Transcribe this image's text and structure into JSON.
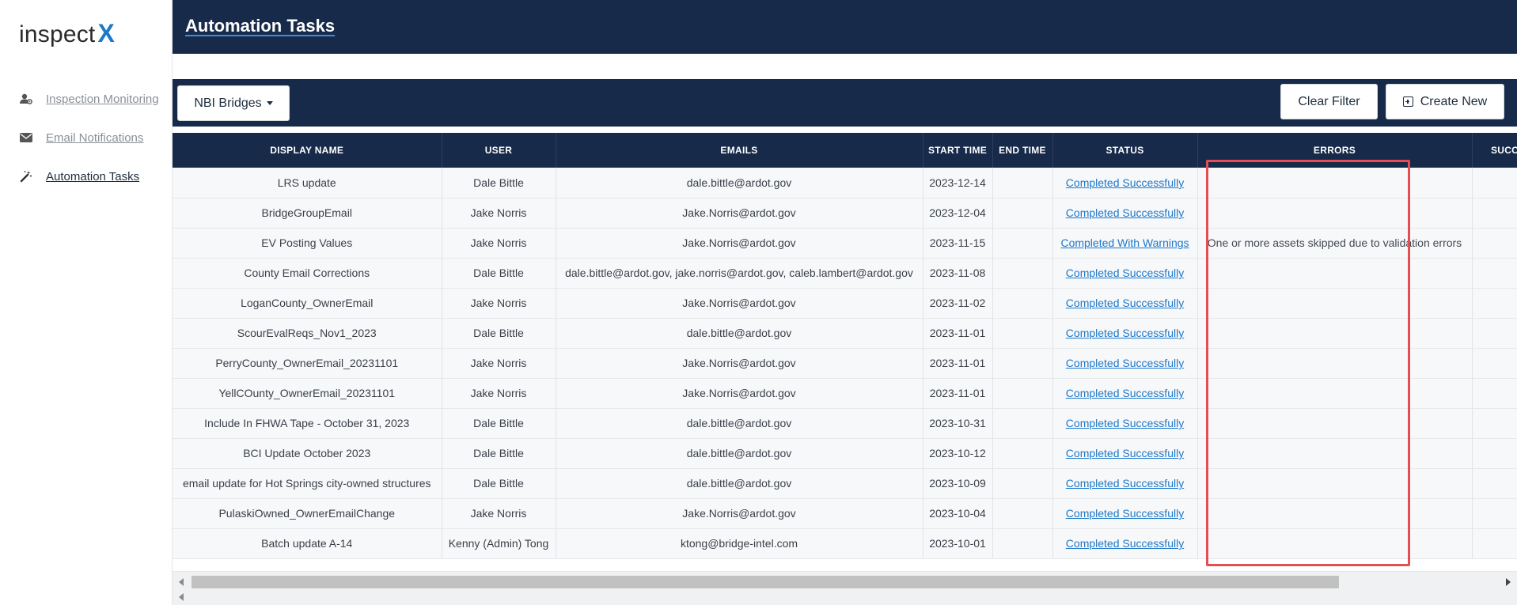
{
  "logo": {
    "text": "inspect",
    "x": "X"
  },
  "sidebar": {
    "items": [
      {
        "label": "Inspection Monitoring",
        "icon": "user-gear-icon"
      },
      {
        "label": "Email Notifications",
        "icon": "envelope-icon"
      },
      {
        "label": "Automation Tasks",
        "icon": "magic-wand-icon"
      }
    ]
  },
  "header": {
    "title": "Automation Tasks"
  },
  "toolbar": {
    "dropdown_label": "NBI Bridges",
    "clear_filter_label": "Clear Filter",
    "create_new_label": "Create New"
  },
  "table": {
    "columns": [
      "DISPLAY NAME",
      "USER",
      "EMAILS",
      "START TIME",
      "END TIME",
      "STATUS",
      "ERRORS",
      "SUCCESS"
    ],
    "rows": [
      {
        "name": "LRS update",
        "user": "Dale Bittle",
        "emails": "dale.bittle@ardot.gov",
        "start": "2023-12-14",
        "end": "",
        "status": "Completed Successfully",
        "errors": "",
        "success": ""
      },
      {
        "name": "BridgeGroupEmail",
        "user": "Jake Norris",
        "emails": "Jake.Norris@ardot.gov",
        "start": "2023-12-04",
        "end": "",
        "status": "Completed Successfully",
        "errors": "",
        "success": ""
      },
      {
        "name": "EV Posting Values",
        "user": "Jake Norris",
        "emails": "Jake.Norris@ardot.gov",
        "start": "2023-11-15",
        "end": "",
        "status": "Completed With Warnings",
        "errors": "One or more assets skipped due to validation errors",
        "success": ""
      },
      {
        "name": "County Email Corrections",
        "user": "Dale Bittle",
        "emails": "dale.bittle@ardot.gov, jake.norris@ardot.gov, caleb.lambert@ardot.gov",
        "start": "2023-11-08",
        "end": "",
        "status": "Completed Successfully",
        "errors": "",
        "success": ""
      },
      {
        "name": "LoganCounty_OwnerEmail",
        "user": "Jake Norris",
        "emails": "Jake.Norris@ardot.gov",
        "start": "2023-11-02",
        "end": "",
        "status": "Completed Successfully",
        "errors": "",
        "success": ""
      },
      {
        "name": "ScourEvalReqs_Nov1_2023",
        "user": "Dale Bittle",
        "emails": "dale.bittle@ardot.gov",
        "start": "2023-11-01",
        "end": "",
        "status": "Completed Successfully",
        "errors": "",
        "success": ""
      },
      {
        "name": "PerryCounty_OwnerEmail_20231101",
        "user": "Jake Norris",
        "emails": "Jake.Norris@ardot.gov",
        "start": "2023-11-01",
        "end": "",
        "status": "Completed Successfully",
        "errors": "",
        "success": ""
      },
      {
        "name": "YellCOunty_OwnerEmail_20231101",
        "user": "Jake Norris",
        "emails": "Jake.Norris@ardot.gov",
        "start": "2023-11-01",
        "end": "",
        "status": "Completed Successfully",
        "errors": "",
        "success": ""
      },
      {
        "name": "Include In FHWA Tape - October 31, 2023",
        "user": "Dale Bittle",
        "emails": "dale.bittle@ardot.gov",
        "start": "2023-10-31",
        "end": "",
        "status": "Completed Successfully",
        "errors": "",
        "success": ""
      },
      {
        "name": "BCI Update October 2023",
        "user": "Dale Bittle",
        "emails": "dale.bittle@ardot.gov",
        "start": "2023-10-12",
        "end": "",
        "status": "Completed Successfully",
        "errors": "",
        "success": ""
      },
      {
        "name": "email update for Hot Springs city-owned structures",
        "user": "Dale Bittle",
        "emails": "dale.bittle@ardot.gov",
        "start": "2023-10-09",
        "end": "",
        "status": "Completed Successfully",
        "errors": "",
        "success": ""
      },
      {
        "name": "PulaskiOwned_OwnerEmailChange",
        "user": "Jake Norris",
        "emails": "Jake.Norris@ardot.gov",
        "start": "2023-10-04",
        "end": "",
        "status": "Completed Successfully",
        "errors": "",
        "success": ""
      },
      {
        "name": "Batch update A-14",
        "user": "Kenny (Admin) Tong",
        "emails": "ktong@bridge-intel.com",
        "start": "2023-10-01",
        "end": "",
        "status": "Completed Successfully",
        "errors": "",
        "success": ""
      }
    ]
  },
  "colors": {
    "navy": "#172a4a",
    "link": "#1e78c8",
    "highlight": "#e54d52",
    "logo_accent": "#1e78c8"
  }
}
